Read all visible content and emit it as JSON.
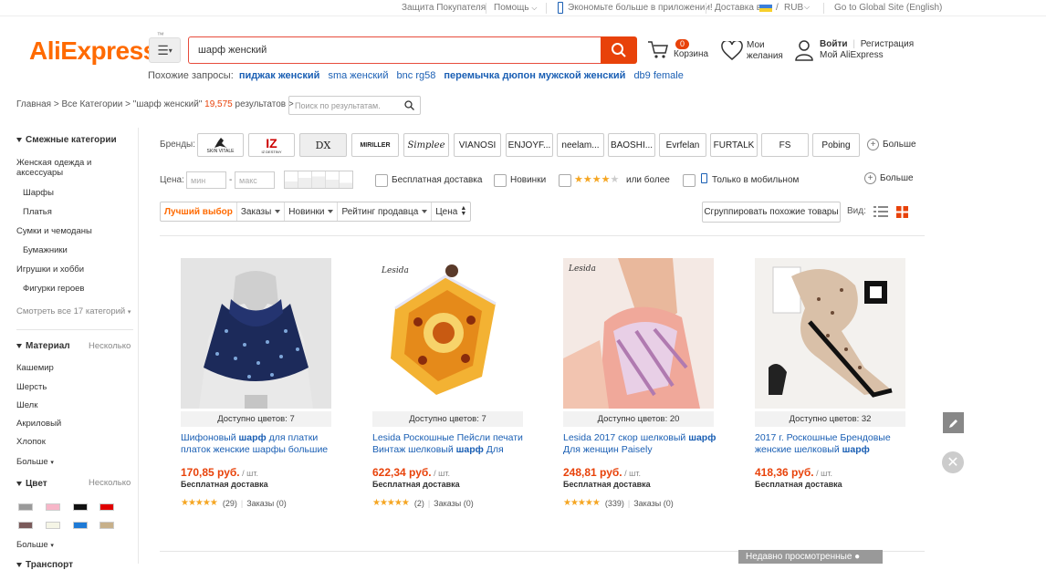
{
  "topbar": {
    "buyer_protection": "Защита Покупателя",
    "help": "Помощь",
    "app_promo": "Экономьте больше в приложении!",
    "ship_to": "Доставка в",
    "currency": "RUB",
    "global_site": "Go to Global Site (English)"
  },
  "header": {
    "logo": "AliExpress",
    "search_value": "шарф женский",
    "cart_count": "0",
    "cart_label": "Корзина",
    "wishlist_l1": "Мои",
    "wishlist_l2": "желания",
    "login": "Войти",
    "register": "Регистрация",
    "my_ali": "Мой AliExpress",
    "related_label": "Похожие запросы:",
    "related": [
      "пиджак женский",
      "sma женский",
      "bnc rg58",
      "перемычка дюпон мужской женский",
      "db9 female"
    ]
  },
  "breadcrumb": {
    "path": "Главная > Все Категории > \"шарф женский\"",
    "count": "19,575",
    "results": "результатов >",
    "search_placeholder": "Поиск по результатам."
  },
  "sidebar": {
    "related_head": "Смежные категории",
    "cat_women": "Женская одежда и",
    "cat_women2": "аксессуары",
    "cat_scarves": "Шарфы",
    "cat_dresses": "Платья",
    "cat_bags": "Сумки и чемоданы",
    "cat_wallets": "Бумажники",
    "cat_toys": "Игрушки и хобби",
    "cat_figures": "Фигурки героев",
    "see_all": "Смотреть все 17 категорий",
    "material_head": "Материал",
    "multiple": "Несколько",
    "materials": [
      "Кашемир",
      "Шерсть",
      "Шелк",
      "Акриловый",
      "Хлопок"
    ],
    "more": "Больше",
    "color_head": "Цвет",
    "colors": [
      "#9a9a9a",
      "#f7b6c8",
      "#111111",
      "#e00000",
      "#7a5a5a",
      "#f5f5e6",
      "#1e7ad6",
      "#c7b08a"
    ],
    "transport_head": "Транспорт"
  },
  "filters": {
    "brands_label": "Бренды:",
    "brands": [
      "SKIN VITALE",
      "IZ DESTINY",
      "DX",
      "MIRILLER",
      "Simplee",
      "VIANOSI",
      "ENJOYF...",
      "neelam...",
      "BAOSHI...",
      "Evrfelan",
      "FURTALK",
      "FS",
      "Pobing"
    ],
    "more": "Больше",
    "price_label": "Цена:",
    "price_min": "мин",
    "price_max": "макс",
    "free_shipping": "Бесплатная доставка",
    "new": "Новинки",
    "or_more": "или более",
    "mobile_only": "Только в мобильном",
    "sort_best": "Лучший выбор",
    "sort_orders": "Заказы",
    "sort_new": "Новинки",
    "sort_seller": "Рейтинг продавца",
    "sort_price": "Цена",
    "group_similar": "Сгруппировать похожие товары",
    "view_label": "Вид:"
  },
  "products": [
    {
      "colors": "Доступно цветов: 7",
      "title_a": "Шифоновый ",
      "title_b": "шарф",
      "title_c": " для платки платок женские шарфы большие",
      "price": "170,85 руб.",
      "unit": " / шт.",
      "ship": "Бесплатная доставка",
      "reviews": "(29)",
      "orders": "Заказы (0)",
      "rating": 4.5
    },
    {
      "colors": "Доступно цветов: 7",
      "title_a": "Lesida Роскошные Пейсли печати Винтаж шелковый ",
      "title_b": "шарф",
      "title_c": " Для",
      "price": "622,34 руб.",
      "unit": " / шт.",
      "ship": "Бесплатная доставка",
      "reviews": "(2)",
      "orders": "Заказы (0)",
      "rating": 5
    },
    {
      "colors": "Доступно цветов: 20",
      "title_a": "Lesida 2017 скор шелковый ",
      "title_b": "шарф",
      "title_c": " Для женщин Paisely",
      "price": "248,81 руб.",
      "unit": " / шт.",
      "ship": "Бесплатная доставка",
      "reviews": "(339)",
      "orders": "Заказы (0)",
      "rating": 4.5
    },
    {
      "colors": "Доступно цветов: 32",
      "title_a": "2017 г. Роскошные Брендовые женские шелковый ",
      "title_b": "шарф",
      "title_c": "",
      "price": "418,36 руб.",
      "unit": " / шт.",
      "ship": "Бесплатная доставка",
      "reviews": "",
      "orders": "",
      "rating": 0
    }
  ],
  "recently_viewed": "Недавно просмотренные"
}
